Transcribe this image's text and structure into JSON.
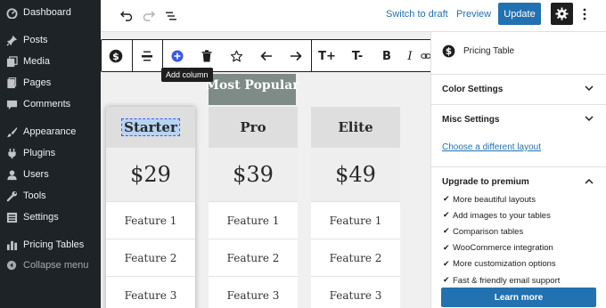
{
  "admin_menu": {
    "items": [
      {
        "label": "Dashboard",
        "icon": "dashboard-icon"
      },
      {
        "label": "Posts",
        "icon": "pin-icon"
      },
      {
        "label": "Media",
        "icon": "media-icon"
      },
      {
        "label": "Pages",
        "icon": "page-icon"
      },
      {
        "label": "Comments",
        "icon": "comment-icon"
      },
      {
        "label": "Appearance",
        "icon": "brush-icon"
      },
      {
        "label": "Plugins",
        "icon": "plug-icon"
      },
      {
        "label": "Users",
        "icon": "user-icon"
      },
      {
        "label": "Tools",
        "icon": "wrench-icon"
      },
      {
        "label": "Settings",
        "icon": "settings-icon"
      },
      {
        "label": "Pricing Tables",
        "icon": "bar-chart-icon"
      },
      {
        "label": "Collapse menu",
        "icon": "collapse-icon"
      }
    ]
  },
  "topbar": {
    "switch_draft": "Switch to draft",
    "preview": "Preview",
    "update": "Update"
  },
  "block_toolbar": {
    "tooltip": "Add column",
    "text_larger": "T+",
    "text_smaller": "T-",
    "bold": "B",
    "italic": "I"
  },
  "pricing": {
    "badge": "Most Popular",
    "columns": [
      {
        "name": "Starter",
        "price": "$29",
        "features": [
          "Feature 1",
          "Feature 2",
          "Feature 3"
        ]
      },
      {
        "name": "Pro",
        "price": "$39",
        "features": [
          "Feature 1",
          "Feature 2",
          "Feature 3"
        ]
      },
      {
        "name": "Elite",
        "price": "$49",
        "features": [
          "Feature 1",
          "Feature 2",
          "Feature 3"
        ]
      }
    ]
  },
  "settings_panel": {
    "block_title": "Pricing Table",
    "color_settings": "Color Settings",
    "misc_settings": "Misc Settings",
    "choose_layout": "Choose a different layout",
    "upgrade_title": "Upgrade to premium",
    "premium_features": [
      "More beautiful layouts",
      "Add images to your tables",
      "Comparison tables",
      "WooCommerce integration",
      "More customization options",
      "Fast & friendly email support"
    ],
    "learn_more": "Learn more"
  },
  "colors": {
    "admin_bg": "#1d2327",
    "accent": "#2271b1",
    "badge": "#7e8b86"
  }
}
